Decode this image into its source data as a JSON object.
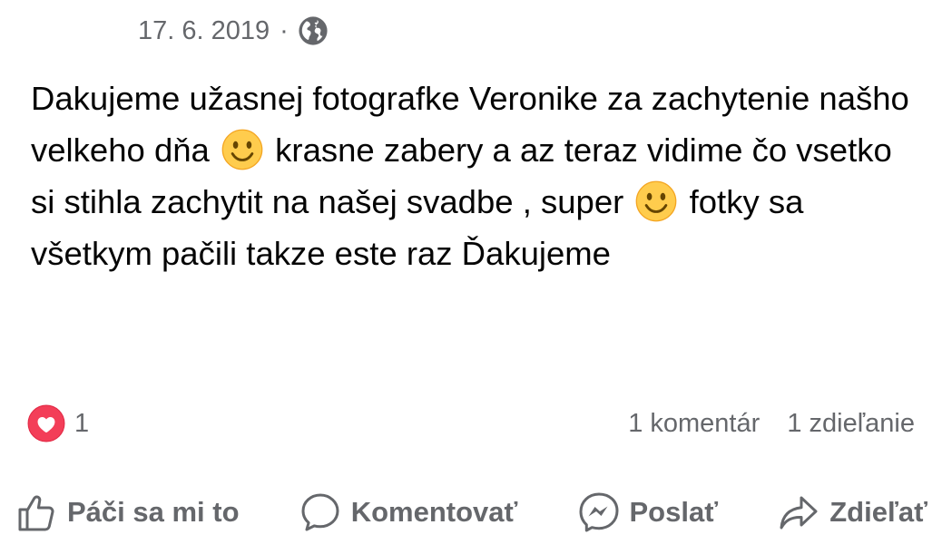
{
  "post": {
    "date": "17. 6. 2019",
    "separator": "·",
    "privacy_icon": "globe-icon",
    "text_segments": [
      "Dakujeme užasnej fotografke Veronike za zachytenie našho velkeho dňa",
      "krasne zabery a az teraz vidime čo vsetko si stihla zachytit na našej svadbe , super",
      "fotky sa všetkym pačili takze este raz Ďakujeme"
    ],
    "emoji_icon": "slightly-smiling-face-emoji"
  },
  "stats": {
    "reaction_icon": "heart-reaction-icon",
    "reaction_count": "1",
    "comments": "1 komentár",
    "shares": "1 zdieľanie"
  },
  "actions": {
    "like": {
      "label": "Páči sa mi to",
      "icon": "thumbs-up-icon"
    },
    "comment": {
      "label": "Komentovať",
      "icon": "comment-bubble-icon"
    },
    "send": {
      "label": "Poslať",
      "icon": "messenger-icon"
    },
    "share": {
      "label": "Zdieľať",
      "icon": "share-arrow-icon"
    }
  },
  "colors": {
    "text": "#050505",
    "secondary_text": "#65676b",
    "heart": "#f33e58",
    "emoji_face": "#ffcc4d"
  }
}
